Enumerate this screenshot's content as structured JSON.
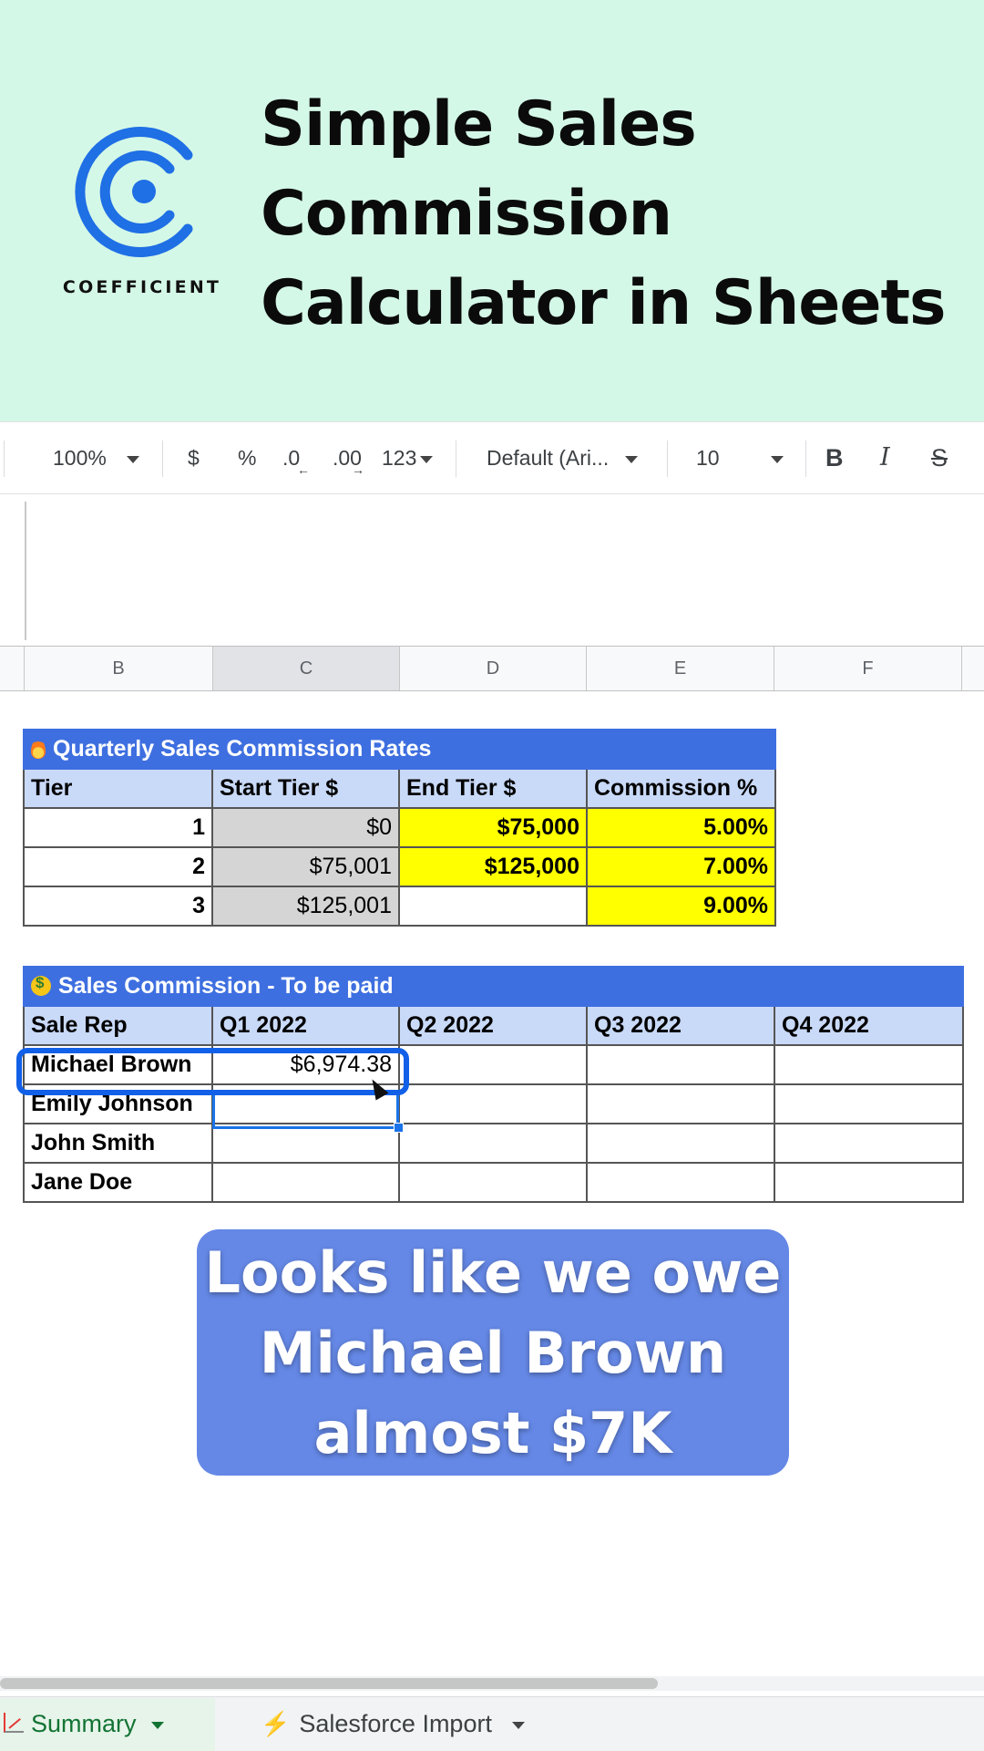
{
  "banner": {
    "brand": "COEFFICIENT",
    "headline_lines": [
      "Simple Sales",
      "Commission",
      "Calculator in Sheets"
    ],
    "colors": {
      "background": "#d4f8e7",
      "logo": "#1f6fe5"
    }
  },
  "toolbar": {
    "zoom": "100%",
    "currency": "$",
    "percent": "%",
    "decrease_decimal": ".0",
    "increase_decimal": ".00",
    "more_formats": "123",
    "font": "Default (Ari...",
    "font_size": "10",
    "bold": "B",
    "italic": "I",
    "strike": "S"
  },
  "columns": [
    "B",
    "C",
    "D",
    "E",
    "F"
  ],
  "rates_table": {
    "title": "Quarterly Sales Commission Rates",
    "headers": [
      "Tier",
      "Start Tier $",
      "End Tier $",
      "Commission %"
    ],
    "rows": [
      {
        "tier": "1",
        "start": "$0",
        "end": "$75,000",
        "commission": "5.00%"
      },
      {
        "tier": "2",
        "start": "$75,001",
        "end": "$125,000",
        "commission": "7.00%"
      },
      {
        "tier": "3",
        "start": "$125,001",
        "end": "",
        "commission": "9.00%"
      }
    ]
  },
  "commission_table": {
    "title": "Sales Commission - To be paid",
    "headers": [
      "Sale Rep",
      "Q1 2022",
      "Q2 2022",
      "Q3 2022",
      "Q4 2022"
    ],
    "rows": [
      {
        "rep": "Michael Brown",
        "q1": "$6,974.38",
        "q2": "",
        "q3": "",
        "q4": ""
      },
      {
        "rep": "Emily Johnson",
        "q1": "",
        "q2": "",
        "q3": "",
        "q4": ""
      },
      {
        "rep": "John Smith",
        "q1": "",
        "q2": "",
        "q3": "",
        "q4": ""
      },
      {
        "rep": "Jane Doe",
        "q1": "",
        "q2": "",
        "q3": "",
        "q4": ""
      }
    ]
  },
  "caption": {
    "lines": [
      "Looks like we owe",
      "Michael Brown",
      "almost $7K"
    ]
  },
  "sheet_tabs": [
    {
      "label": "Summary"
    },
    {
      "label": "Salesforce Import"
    }
  ]
}
